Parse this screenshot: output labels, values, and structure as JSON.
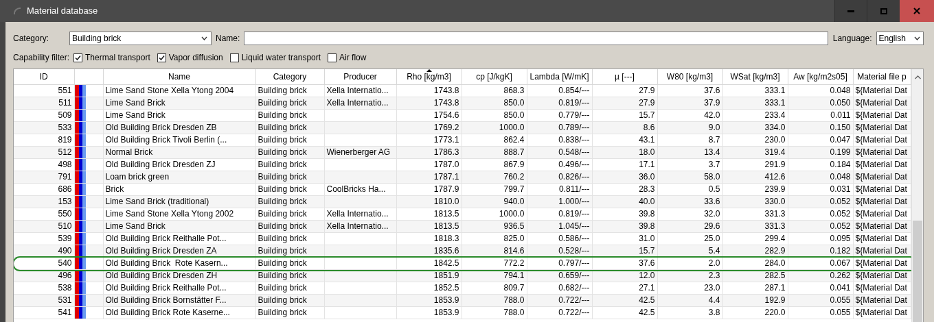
{
  "window": {
    "title": "Material database"
  },
  "filters": {
    "category_label": "Category:",
    "category": "Building brick",
    "name_label": "Name:",
    "language_label": "Language:",
    "language": "English"
  },
  "capability_filter": {
    "label": "Capability filter:",
    "options": [
      {
        "label": "Thermal transport",
        "checked": true
      },
      {
        "label": "Vapor diffusion",
        "checked": true
      },
      {
        "label": "Liquid water transport",
        "checked": false
      },
      {
        "label": "Air flow",
        "checked": false
      }
    ]
  },
  "table": {
    "columns": [
      {
        "label": "ID",
        "sorted": false
      },
      {
        "sorted": false
      },
      {
        "label": "Name",
        "sorted": false
      },
      {
        "label": "Category",
        "sorted": false
      },
      {
        "label": "Producer",
        "sorted": false
      },
      {
        "label": "Rho [kg/m3]",
        "sorted": true
      },
      {
        "label": "cp [J/kgK]",
        "sorted": false
      },
      {
        "label": "Lambda [W/mK]",
        "sorted": false
      },
      {
        "label": "µ [---]",
        "sorted": false
      },
      {
        "label": "W80 [kg/m3]",
        "sorted": false
      },
      {
        "label": "WSat [kg/m3]",
        "sorted": false
      },
      {
        "label": "Aw [kg/m2s05]",
        "sorted": false
      },
      {
        "label": "Material file p",
        "sorted": false
      }
    ],
    "rows": [
      {
        "circled": false,
        "cells": [
          "551",
          "",
          "Lime Sand Stone Xella Ytong 2004",
          "Building brick",
          "Xella Internatio...",
          "1743.8",
          "868.3",
          "0.854/---",
          "27.9",
          "37.6",
          "333.1",
          "0.048",
          "${Material Dat"
        ]
      },
      {
        "circled": false,
        "cells": [
          "511",
          "",
          "Lime Sand Brick",
          "Building brick",
          "Xella Internatio...",
          "1743.8",
          "850.0",
          "0.819/---",
          "27.9",
          "37.9",
          "333.1",
          "0.050",
          "${Material Dat"
        ]
      },
      {
        "circled": false,
        "cells": [
          "509",
          "",
          "Lime Sand Brick",
          "Building brick",
          "",
          "1754.6",
          "850.0",
          "0.779/---",
          "15.7",
          "42.0",
          "233.4",
          "0.011",
          "${Material Dat"
        ]
      },
      {
        "circled": false,
        "cells": [
          "533",
          "",
          "Old Building Brick Dresden ZB",
          "Building brick",
          "",
          "1769.2",
          "1000.0",
          "0.789/---",
          "8.6",
          "9.0",
          "334.0",
          "0.150",
          "${Material Dat"
        ]
      },
      {
        "circled": false,
        "cells": [
          "819",
          "",
          "Old Building Brick Tivoli Berlin (...",
          "Building brick",
          "",
          "1773.1",
          "862.4",
          "0.838/---",
          "43.1",
          "8.7",
          "230.0",
          "0.047",
          "${Material Dat"
        ]
      },
      {
        "circled": false,
        "cells": [
          "512",
          "",
          "Normal Brick",
          "Building brick",
          "Wienerberger AG",
          "1786.3",
          "888.7",
          "0.548/---",
          "18.0",
          "13.4",
          "319.4",
          "0.199",
          "${Material Dat"
        ]
      },
      {
        "circled": false,
        "cells": [
          "498",
          "",
          "Old Building Brick Dresden ZJ",
          "Building brick",
          "",
          "1787.0",
          "867.9",
          "0.496/---",
          "17.1",
          "3.7",
          "291.9",
          "0.184",
          "${Material Dat"
        ]
      },
      {
        "circled": false,
        "cells": [
          "791",
          "",
          "Loam brick green",
          "Building brick",
          "",
          "1787.1",
          "760.2",
          "0.826/---",
          "36.0",
          "58.0",
          "412.6",
          "0.048",
          "${Material Dat"
        ]
      },
      {
        "circled": false,
        "cells": [
          "686",
          "",
          "Brick",
          "Building brick",
          "CoolBricks Ha...",
          "1787.9",
          "799.7",
          "0.811/---",
          "28.3",
          "0.5",
          "239.9",
          "0.031",
          "${Material Dat"
        ]
      },
      {
        "circled": false,
        "cells": [
          "153",
          "",
          "Lime Sand Brick (traditional)",
          "Building brick",
          "",
          "1810.0",
          "940.0",
          "1.000/---",
          "40.0",
          "33.6",
          "330.0",
          "0.052",
          "${Material Dat"
        ]
      },
      {
        "circled": false,
        "cells": [
          "550",
          "",
          "Lime Sand Stone Xella Ytong 2002",
          "Building brick",
          "Xella Internatio...",
          "1813.5",
          "1000.0",
          "0.819/---",
          "39.8",
          "32.0",
          "331.3",
          "0.052",
          "${Material Dat"
        ]
      },
      {
        "circled": false,
        "cells": [
          "510",
          "",
          "Lime Sand Brick",
          "Building brick",
          "Xella Internatio...",
          "1813.5",
          "936.5",
          "1.045/---",
          "39.8",
          "29.6",
          "331.3",
          "0.052",
          "${Material Dat"
        ]
      },
      {
        "circled": false,
        "cells": [
          "539",
          "",
          "Old Building Brick Reithalle Pot...",
          "Building brick",
          "",
          "1818.3",
          "825.0",
          "0.586/---",
          "31.0",
          "25.0",
          "299.4",
          "0.095",
          "${Material Dat"
        ]
      },
      {
        "circled": false,
        "cells": [
          "490",
          "",
          "Old Building Brick Dresden ZA",
          "Building brick",
          "",
          "1835.6",
          "814.6",
          "0.528/---",
          "15.7",
          "5.4",
          "282.9",
          "0.182",
          "${Material Dat"
        ]
      },
      {
        "circled": true,
        "cells": [
          "540",
          "",
          "Old Building Brick  Rote Kasern...",
          "Building brick",
          "",
          "1842.5",
          "772.2",
          "0.797/---",
          "37.6",
          "2.0",
          "284.0",
          "0.067",
          "${Material Dat"
        ]
      },
      {
        "circled": false,
        "cells": [
          "496",
          "",
          "Old Building Brick Dresden ZH",
          "Building brick",
          "",
          "1851.9",
          "794.1",
          "0.659/---",
          "12.0",
          "2.3",
          "282.5",
          "0.262",
          "${Material Dat"
        ]
      },
      {
        "circled": false,
        "cells": [
          "538",
          "",
          "Old Building Brick Reithalle Pot...",
          "Building brick",
          "",
          "1852.5",
          "809.7",
          "0.682/---",
          "27.1",
          "23.0",
          "287.1",
          "0.041",
          "${Material Dat"
        ]
      },
      {
        "circled": false,
        "cells": [
          "531",
          "",
          "Old Building Brick Bornstätter F...",
          "Building brick",
          "",
          "1853.9",
          "788.0",
          "0.722/---",
          "42.5",
          "4.4",
          "192.9",
          "0.055",
          "${Material Dat"
        ]
      },
      {
        "circled": false,
        "cells": [
          "541",
          "",
          "Old Building Brick Rote Kaserne...",
          "Building brick",
          "",
          "1853.9",
          "788.0",
          "0.722/---",
          "42.5",
          "3.8",
          "220.0",
          "0.055",
          "${Material Dat"
        ]
      }
    ]
  }
}
